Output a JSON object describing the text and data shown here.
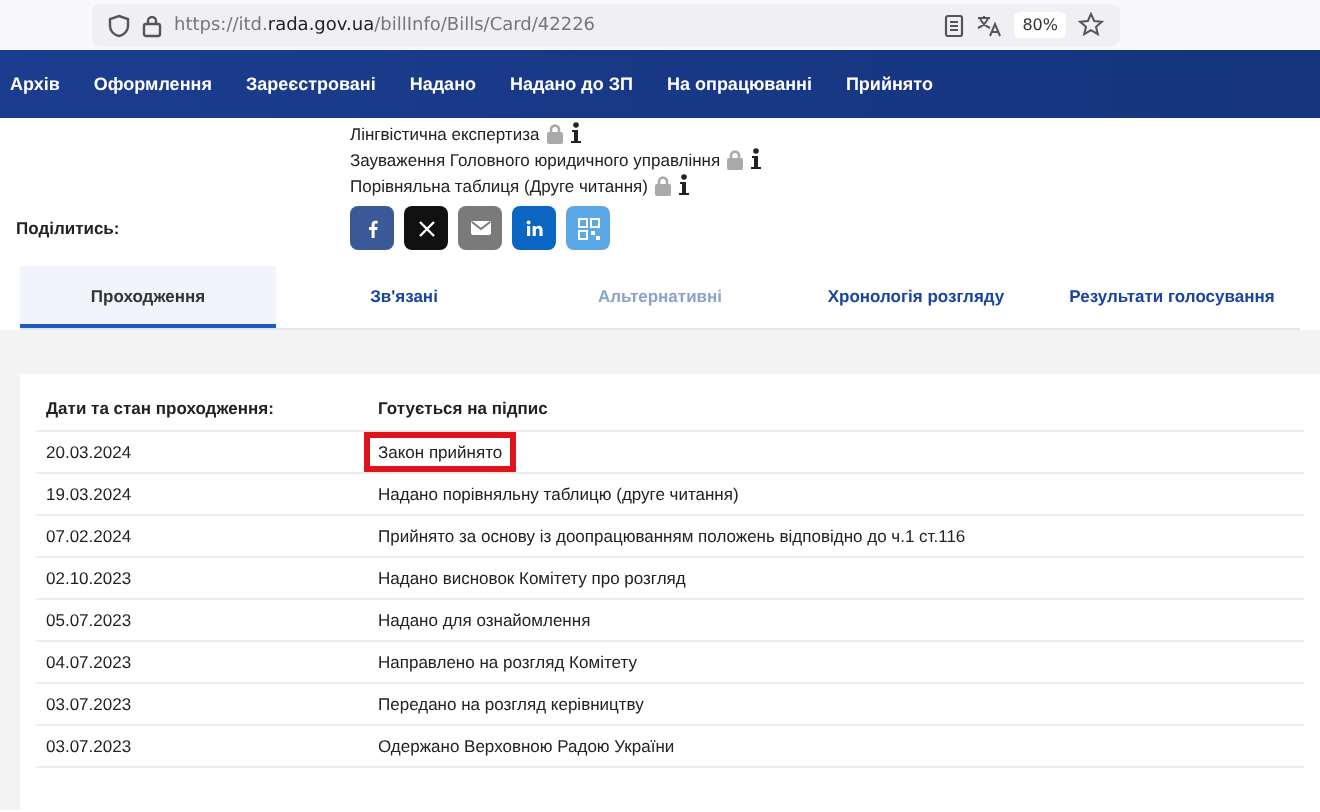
{
  "browser": {
    "url": "https://itd.**rada.gov.ua**/billInfo/Bills/Card/42226",
    "zoom": "80%"
  },
  "nav": {
    "items": [
      "Архів",
      "Оформлення",
      "Зареєстровані",
      "Надано",
      "Надано до ЗП",
      "На опрацюванні",
      "Прийнято"
    ]
  },
  "documents": [
    {
      "title": "Лінгвістична експертиза"
    },
    {
      "title": "Зауваження Головного юридичного управління"
    },
    {
      "title": "Порівняльна таблиця (Друге читання)"
    }
  ],
  "share": {
    "label": "Поділитись:",
    "buttons": [
      {
        "kind": "facebook"
      },
      {
        "kind": "x"
      },
      {
        "kind": "email"
      },
      {
        "kind": "linkedin"
      },
      {
        "kind": "qr"
      }
    ]
  },
  "tabs": [
    {
      "label": "Проходження",
      "selected": true,
      "disabled": false
    },
    {
      "label": "Зв'язані",
      "selected": false,
      "disabled": false
    },
    {
      "label": "Альтернативні",
      "selected": false,
      "disabled": true
    },
    {
      "label": "Хронологія розгляду",
      "selected": false,
      "disabled": false
    },
    {
      "label": "Результати голосування",
      "selected": false,
      "disabled": false
    }
  ],
  "table": {
    "columns": [
      "Дати та стан проходження:",
      "Готується на підпис"
    ],
    "rows": [
      {
        "date": "20.03.2024",
        "status": "Закон прийнято",
        "highlighted": true
      },
      {
        "date": "19.03.2024",
        "status": "Надано порівняльну таблицю (друге читання)",
        "highlighted": false
      },
      {
        "date": "07.02.2024",
        "status": "Прийнято за основу із доопрацюванням положень відповідно до ч.1 ст.116",
        "highlighted": false
      },
      {
        "date": "02.10.2023",
        "status": "Надано висновок Комітету про розгляд",
        "highlighted": false
      },
      {
        "date": "05.07.2023",
        "status": "Надано для ознайомлення",
        "highlighted": false
      },
      {
        "date": "04.07.2023",
        "status": "Направлено на розгляд Комітету",
        "highlighted": false
      },
      {
        "date": "03.07.2023",
        "status": "Передано на розгляд керівництву",
        "highlighted": false
      },
      {
        "date": "03.07.2023",
        "status": "Одержано Верховною Радою України",
        "highlighted": false
      }
    ]
  }
}
